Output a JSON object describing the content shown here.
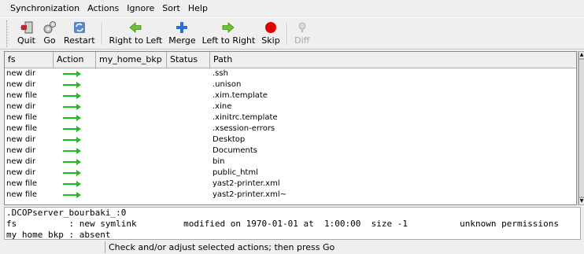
{
  "menu": [
    "Synchronization",
    "Actions",
    "Ignore",
    "Sort",
    "Help"
  ],
  "toolbar": {
    "quit": "Quit",
    "go": "Go",
    "restart": "Restart",
    "right_to_left": "Right to Left",
    "merge": "Merge",
    "left_to_right": "Left to Right",
    "skip": "Skip",
    "diff": "Diff"
  },
  "table": {
    "headers": [
      "fs",
      "Action",
      "my_home_bkp",
      "Status",
      "Path"
    ],
    "rows": [
      {
        "fs": "new dir",
        "path": ".ssh"
      },
      {
        "fs": "new dir",
        "path": ".unison"
      },
      {
        "fs": "new file",
        "path": ".xim.template"
      },
      {
        "fs": "new dir",
        "path": ".xine"
      },
      {
        "fs": "new file",
        "path": ".xinitrc.template"
      },
      {
        "fs": "new file",
        "path": ".xsession-errors"
      },
      {
        "fs": "new dir",
        "path": "Desktop"
      },
      {
        "fs": "new dir",
        "path": "Documents"
      },
      {
        "fs": "new dir",
        "path": "bin"
      },
      {
        "fs": "new dir",
        "path": "public_html"
      },
      {
        "fs": "new file",
        "path": "yast2-printer.xml"
      },
      {
        "fs": "new file",
        "path": "yast2-printer.xml~"
      }
    ]
  },
  "details": {
    "line1": ".DCOPserver_bourbaki_:0",
    "line2": "fs          : new symlink         modified on 1970-01-01 at  1:00:00  size -1          unknown permissions",
    "line3": "my_home_bkp : absent"
  },
  "status": "Check and/or adjust selected actions; then press Go",
  "colors": {
    "arrow": "#1dc11d",
    "skip": "#e00000",
    "merge": "#2a6fd6",
    "direction": "#6cc432",
    "quit": "#c8232a"
  }
}
